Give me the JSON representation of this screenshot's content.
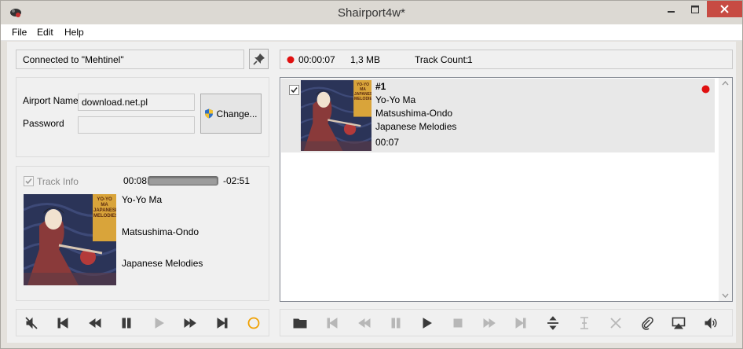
{
  "window": {
    "title": "Shairport4w*"
  },
  "menu": {
    "items": [
      "File",
      "Edit",
      "Help"
    ]
  },
  "status": {
    "connection": "Connected to \"Mehtinel\"",
    "recording_time": "00:00:07",
    "file_size": "1,3 MB",
    "track_count_label": "Track Count:",
    "track_count": "1"
  },
  "airport": {
    "name_label": "Airport Name",
    "name_value": "download.net.pl",
    "password_label": "Password",
    "password_value": "",
    "change_button": "Change..."
  },
  "now_playing": {
    "track_info_label": "Track Info",
    "track_info_checked": true,
    "elapsed": "00:08",
    "remaining": "-02:51",
    "progress_fraction": 0.05,
    "artist": "Yo-Yo Ma",
    "title": "Matsushima-Ondo",
    "album": "Japanese Melodies",
    "album_art_text": [
      "YO-YO MA",
      "JAPANESE",
      "MELODIES"
    ]
  },
  "recordings": [
    {
      "number": "#1",
      "artist": "Yo-Yo Ma",
      "title": "Matsushima-Ondo",
      "album": "Japanese Melodies",
      "duration": "00:07",
      "checked": true
    }
  ],
  "colors": {
    "record_red": "#e01010",
    "close_button": "#c74b43",
    "ring_orange": "#f0a000",
    "art_background": "#2b3458",
    "art_band": "#d9a43a"
  }
}
